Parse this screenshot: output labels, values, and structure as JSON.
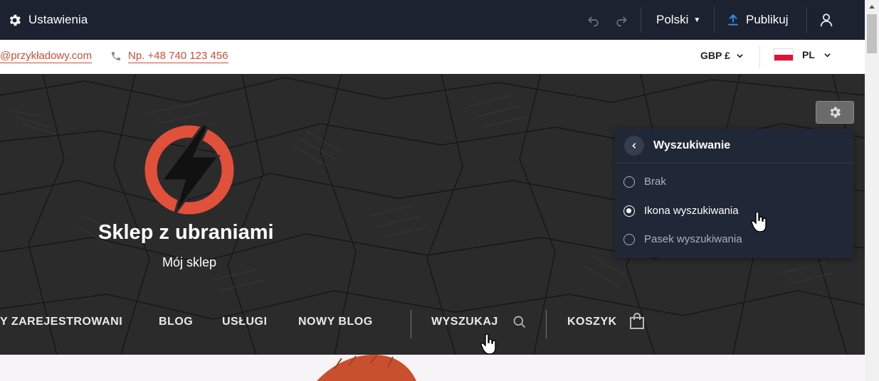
{
  "editor_bar": {
    "settings_label": "Ustawienia",
    "language_label": "Polski",
    "publish_label": "Publikuj"
  },
  "contact": {
    "email": "@przykładowy.com",
    "phone": "Np. +48 740 123 456",
    "currency": "GBP £",
    "locale": "PL"
  },
  "header": {
    "shop_title": "Sklep z ubraniami",
    "shop_subtitle": "Mój sklep",
    "logo_color": "#e0503a"
  },
  "nav": {
    "items": [
      {
        "label": "Y ZAREJESTROWANI"
      },
      {
        "label": "BLOG"
      },
      {
        "label": "USŁUGI"
      },
      {
        "label": "NOWY BLOG"
      },
      {
        "label": "WYSZUKAJ"
      },
      {
        "label": "KOSZYK"
      }
    ]
  },
  "search_panel": {
    "title": "Wyszukiwanie",
    "options": [
      {
        "label": "Brak",
        "selected": false
      },
      {
        "label": "Ikona wyszukiwania",
        "selected": true
      },
      {
        "label": "Pasek wyszukiwania",
        "selected": false
      }
    ]
  },
  "colors": {
    "editor_bar_bg": "#1c2230",
    "accent_link": "#d64e36",
    "publish_icon": "#2d8fe6"
  }
}
